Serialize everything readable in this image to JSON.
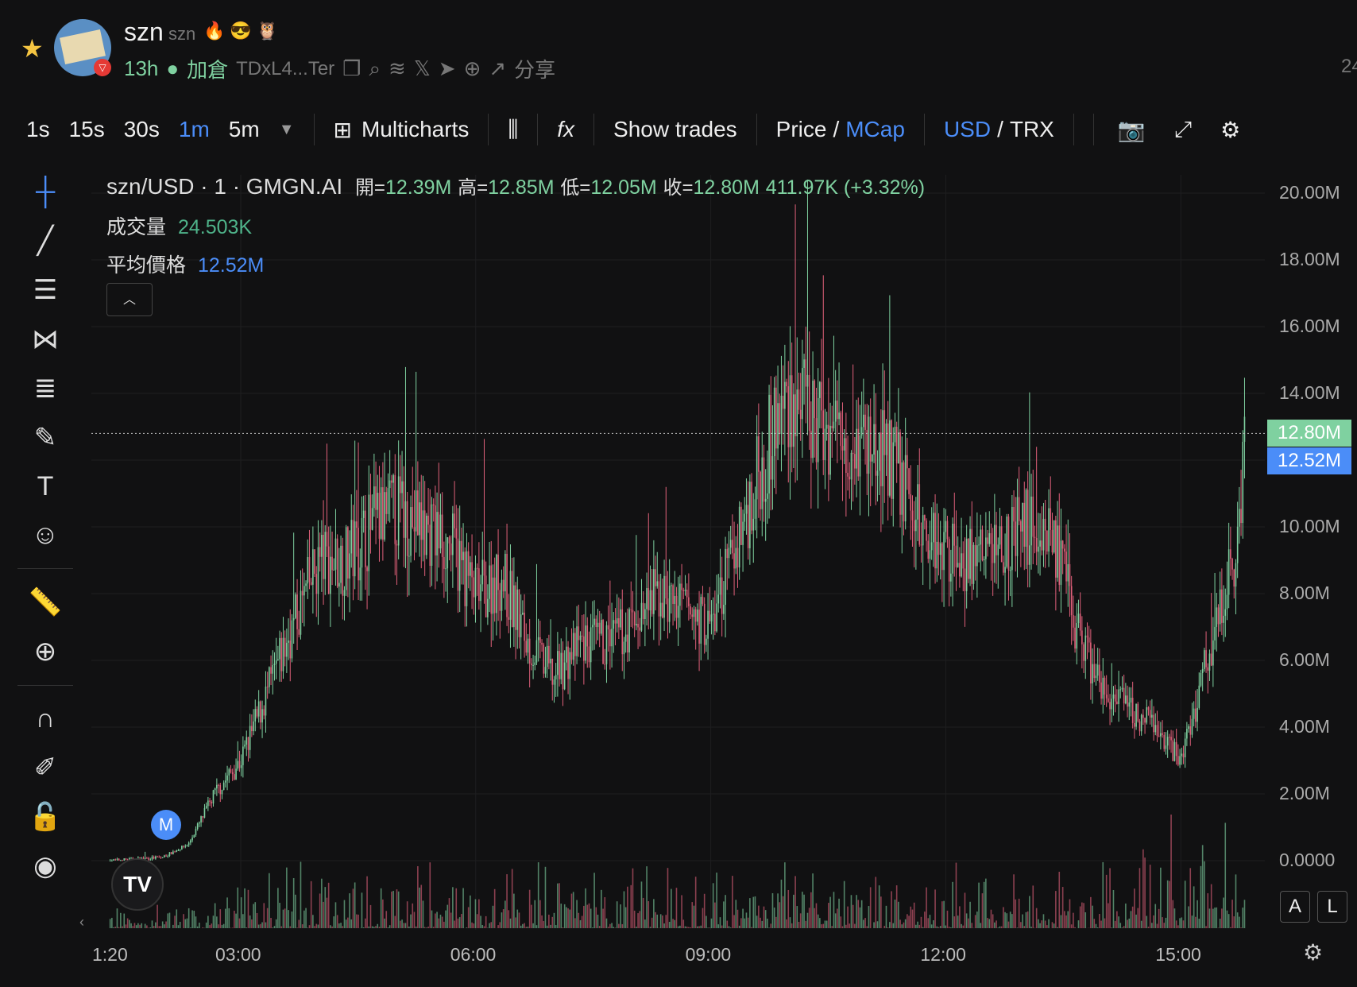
{
  "header": {
    "name": "szn",
    "ticker": "szn",
    "age": "13h",
    "add_label": "加倉",
    "address": "TDxL4...Ter",
    "share_label": "分享",
    "cut_right": "24"
  },
  "toolbar": {
    "intervals": [
      "1s",
      "15s",
      "30s",
      "1m",
      "5m"
    ],
    "active_interval": "1m",
    "multicharts": "Multicharts",
    "show_trades": "Show trades",
    "price": "Price",
    "mcap": "MCap",
    "usd": "USD",
    "trx": "TRX"
  },
  "legend": {
    "symbol": "szn/USD · 1 · GMGN.AI",
    "open_label": "開=",
    "open": "12.39M",
    "high_label": "高=",
    "high": "12.85M",
    "low_label": "低=",
    "low": "12.05M",
    "close_label": "收=",
    "close": "12.80M",
    "change": "411.97K (+3.32%)",
    "volume_label": "成交量",
    "volume": "24.503K",
    "avg_label": "平均價格",
    "avg": "12.52M"
  },
  "colors": {
    "up": "#7fd1a0",
    "down": "#e0607a",
    "accent": "#4b8df8",
    "bg": "#111112"
  },
  "chart_data": {
    "type": "candlestick",
    "y_ticks": [
      "20.00M",
      "18.00M",
      "16.00M",
      "14.00M",
      "12.00M",
      "10.00M",
      "8.00M",
      "6.00M",
      "4.00M",
      "2.00M",
      "0.0000"
    ],
    "x_ticks": [
      "01:20",
      "03:00",
      "06:00",
      "09:00",
      "12:00",
      "15:00"
    ],
    "ylim": [
      0,
      20
    ],
    "price_path": [
      [
        "01:20",
        0
      ],
      [
        "02:00",
        0.1
      ],
      [
        "02:20",
        0.5
      ],
      [
        "02:40",
        2
      ],
      [
        "03:00",
        3
      ],
      [
        "03:20",
        5
      ],
      [
        "03:40",
        7
      ],
      [
        "04:00",
        9
      ],
      [
        "04:20",
        9
      ],
      [
        "04:40",
        10
      ],
      [
        "05:00",
        10.5
      ],
      [
        "05:20",
        10
      ],
      [
        "05:40",
        9.5
      ],
      [
        "06:00",
        8
      ],
      [
        "06:20",
        8.5
      ],
      [
        "06:40",
        6.5
      ],
      [
        "07:00",
        5.5
      ],
      [
        "07:20",
        6.5
      ],
      [
        "07:40",
        6.5
      ],
      [
        "08:00",
        7
      ],
      [
        "08:20",
        8
      ],
      [
        "08:40",
        7.5
      ],
      [
        "09:00",
        7
      ],
      [
        "09:20",
        9.5
      ],
      [
        "09:40",
        12
      ],
      [
        "10:00",
        14
      ],
      [
        "10:20",
        13
      ],
      [
        "10:40",
        13
      ],
      [
        "11:00",
        12.5
      ],
      [
        "11:20",
        12
      ],
      [
        "11:40",
        10
      ],
      [
        "12:00",
        9.5
      ],
      [
        "12:20",
        9
      ],
      [
        "12:40",
        9.5
      ],
      [
        "13:00",
        10
      ],
      [
        "13:20",
        10
      ],
      [
        "13:40",
        7
      ],
      [
        "14:00",
        5
      ],
      [
        "14:20",
        4.5
      ],
      [
        "14:40",
        4
      ],
      [
        "15:00",
        3
      ],
      [
        "15:20",
        6
      ],
      [
        "15:40",
        9
      ],
      [
        "15:50",
        12.8
      ]
    ],
    "last_price": "12.80M",
    "avg_price": "12.52M"
  },
  "markers": {
    "m": "M"
  },
  "buttons": {
    "a": "A",
    "l": "L"
  }
}
